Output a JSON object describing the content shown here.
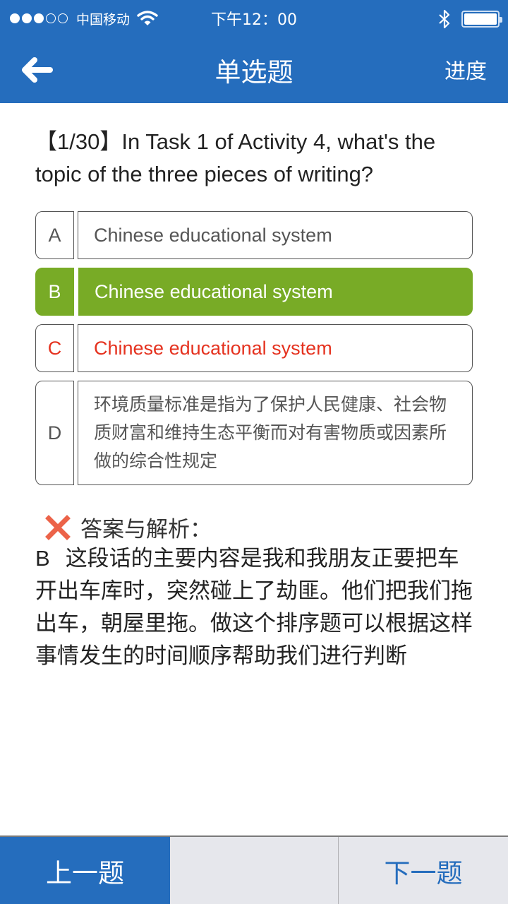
{
  "status_bar": {
    "signal_strength": "3/5",
    "carrier": "中国移动",
    "wifi_icon": "wifi-icon",
    "time": "下午12：00",
    "bluetooth_icon": "bluetooth-icon",
    "battery_level": "100%"
  },
  "nav": {
    "back_icon": "arrow-left-icon",
    "title": "单选题",
    "progress_label": "进度"
  },
  "question": {
    "number": "【1/30】",
    "text": "In Task 1 of Activity 4, what's the topic of the three pieces of writing?"
  },
  "options": [
    {
      "letter": "A",
      "text": "Chinese educational system",
      "state": "normal"
    },
    {
      "letter": "B",
      "text": "Chinese educational system",
      "state": "correct"
    },
    {
      "letter": "C",
      "text": "Chinese educational system",
      "state": "wrong"
    },
    {
      "letter": "D",
      "text": "环境质量标准是指为了保护人民健康、社会物质财富和维持生态平衡而对有害物质或因素所做的综合性规定",
      "state": "normal"
    }
  ],
  "analysis": {
    "result_icon": "cross-icon",
    "heading": "答案与解析：",
    "answer": "B",
    "explanation": "这段话的主要内容是我和我朋友正要把车开出车库时，突然碰上了劫匪。他们把我们拖出车，朝屋里拖。做这个排序题可以根据这样事情发生的时间顺序帮助我们进行判断"
  },
  "bottom_bar": {
    "prev_label": "上一题",
    "next_label": "下一题"
  },
  "colors": {
    "primary_blue": "#256dbd",
    "correct_green": "#78ab26",
    "wrong_red": "#e5321f",
    "cross_icon": "#ec6349",
    "bottom_bar_bg": "#e6e7ec"
  }
}
